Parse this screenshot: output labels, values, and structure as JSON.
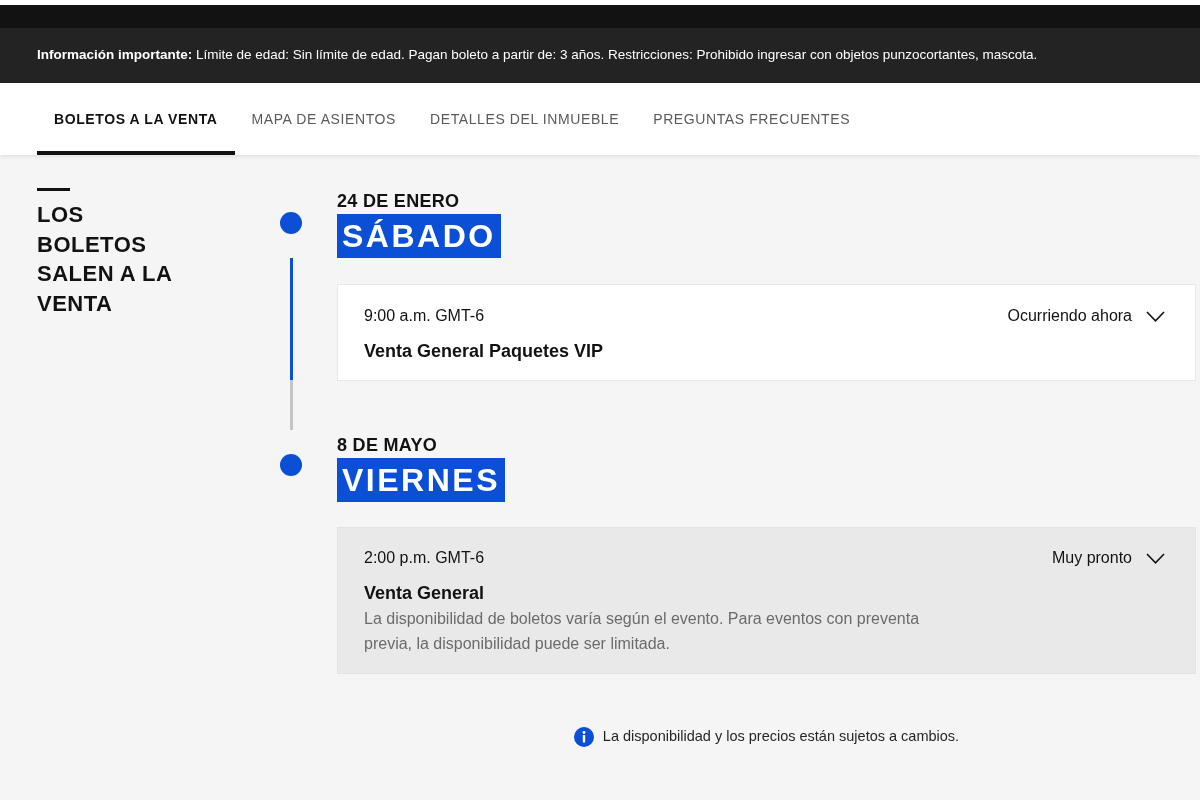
{
  "info_bar": {
    "text": "**Información importante:** Límite de edad: Sin límite de edad. Pagan boleto a partir de: 3 años. Restricciones: Prohibido ingresar con objetos punzocortantes, mascota."
  },
  "tabs": [
    {
      "label": "BOLETOS A LA VENTA",
      "selected": true
    },
    {
      "label": "MAPA DE ASIENTOS",
      "selected": false
    },
    {
      "label": "DETALLES DEL INMUEBLE",
      "selected": false
    },
    {
      "label": "PREGUNTAS FRECUENTES",
      "selected": false
    }
  ],
  "section": {
    "heading": "LOS BOLETOS SALEN A LA VENTA"
  },
  "timeline": {
    "level": 0.71,
    "days": [
      {
        "date": "24 DE ENERO",
        "weekday": "SÁBADO",
        "sales": [
          {
            "time": "9:00 a.m. GMT-6",
            "title": "Venta General Paquetes VIP",
            "status": "Ocurriendo ahora",
            "current": true
          }
        ]
      },
      {
        "date": "8 DE MAYO",
        "weekday": "VIERNES",
        "sales": [
          {
            "time": "2:00 p.m. GMT-6",
            "title": "Venta General",
            "description": "La disponibilidad de boletos varía según el evento. Para eventos con preventa previa, la disponibilidad puede ser limitada.",
            "status": "Muy pronto",
            "current": false
          }
        ]
      }
    ]
  },
  "footer_note": "La disponibilidad y los precios están sujetos a cambios."
}
